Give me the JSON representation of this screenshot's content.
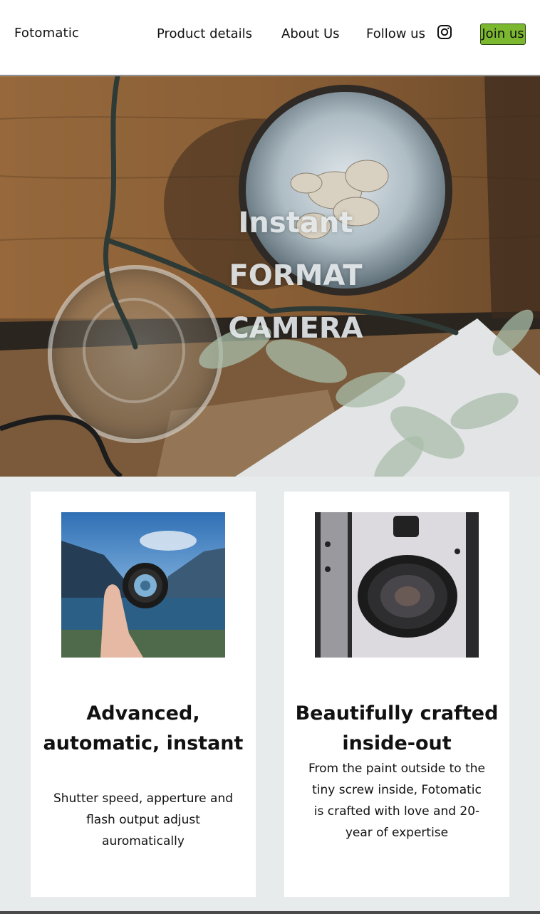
{
  "header": {
    "brand": "Fotomatic",
    "nav": {
      "product_details": "Product details",
      "about_us": "About Us",
      "follow_us": "Follow us"
    },
    "social_icon": "instagram-icon",
    "join_label": "Join us",
    "join_color": "#7cb82f"
  },
  "hero": {
    "line1": "Instant",
    "line2": "FORMAT",
    "line3": "CAMERA",
    "image": "top-down photo of wooden table with ceramic bowl, glass vase and plant"
  },
  "cards": [
    {
      "image": "hand holding a camera lens against a lake and mountains",
      "title": "Advanced, automatic, instant",
      "text": "Shutter speed, apperture and flash output adjust auromatically"
    },
    {
      "image": "close-up of a silver instant camera lens",
      "title": "Beautifully crafted inside-out",
      "text": "From the paint outside to the tiny screw inside, Fotomatic is crafted with love and 20-year of expertise"
    }
  ],
  "colors": {
    "page_background": "#e7ebec",
    "card_background": "#ffffff",
    "hero_text": "#ecf0f2"
  }
}
